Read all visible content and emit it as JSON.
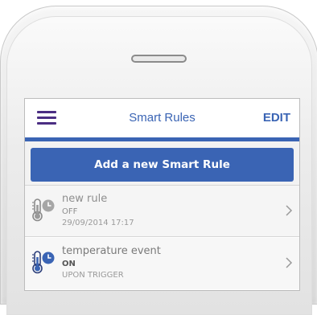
{
  "header": {
    "title": "Smart Rules",
    "edit_label": "EDIT",
    "menu_icon": "hamburger-menu-icon"
  },
  "add_button": {
    "label": "Add a new Smart Rule"
  },
  "rules": [
    {
      "name": "new rule",
      "status": "OFF",
      "detail": "29/09/2014 17:17",
      "icon": "thermometer-clock-icon",
      "active": false
    },
    {
      "name": "temperature event",
      "status": "ON",
      "detail": "UPON TRIGGER",
      "icon": "thermometer-clock-icon",
      "active": true
    }
  ],
  "colors": {
    "accent_blue": "#3a64b4",
    "menu_purple": "#4b2e83",
    "text_grey": "#8e8e8e"
  }
}
